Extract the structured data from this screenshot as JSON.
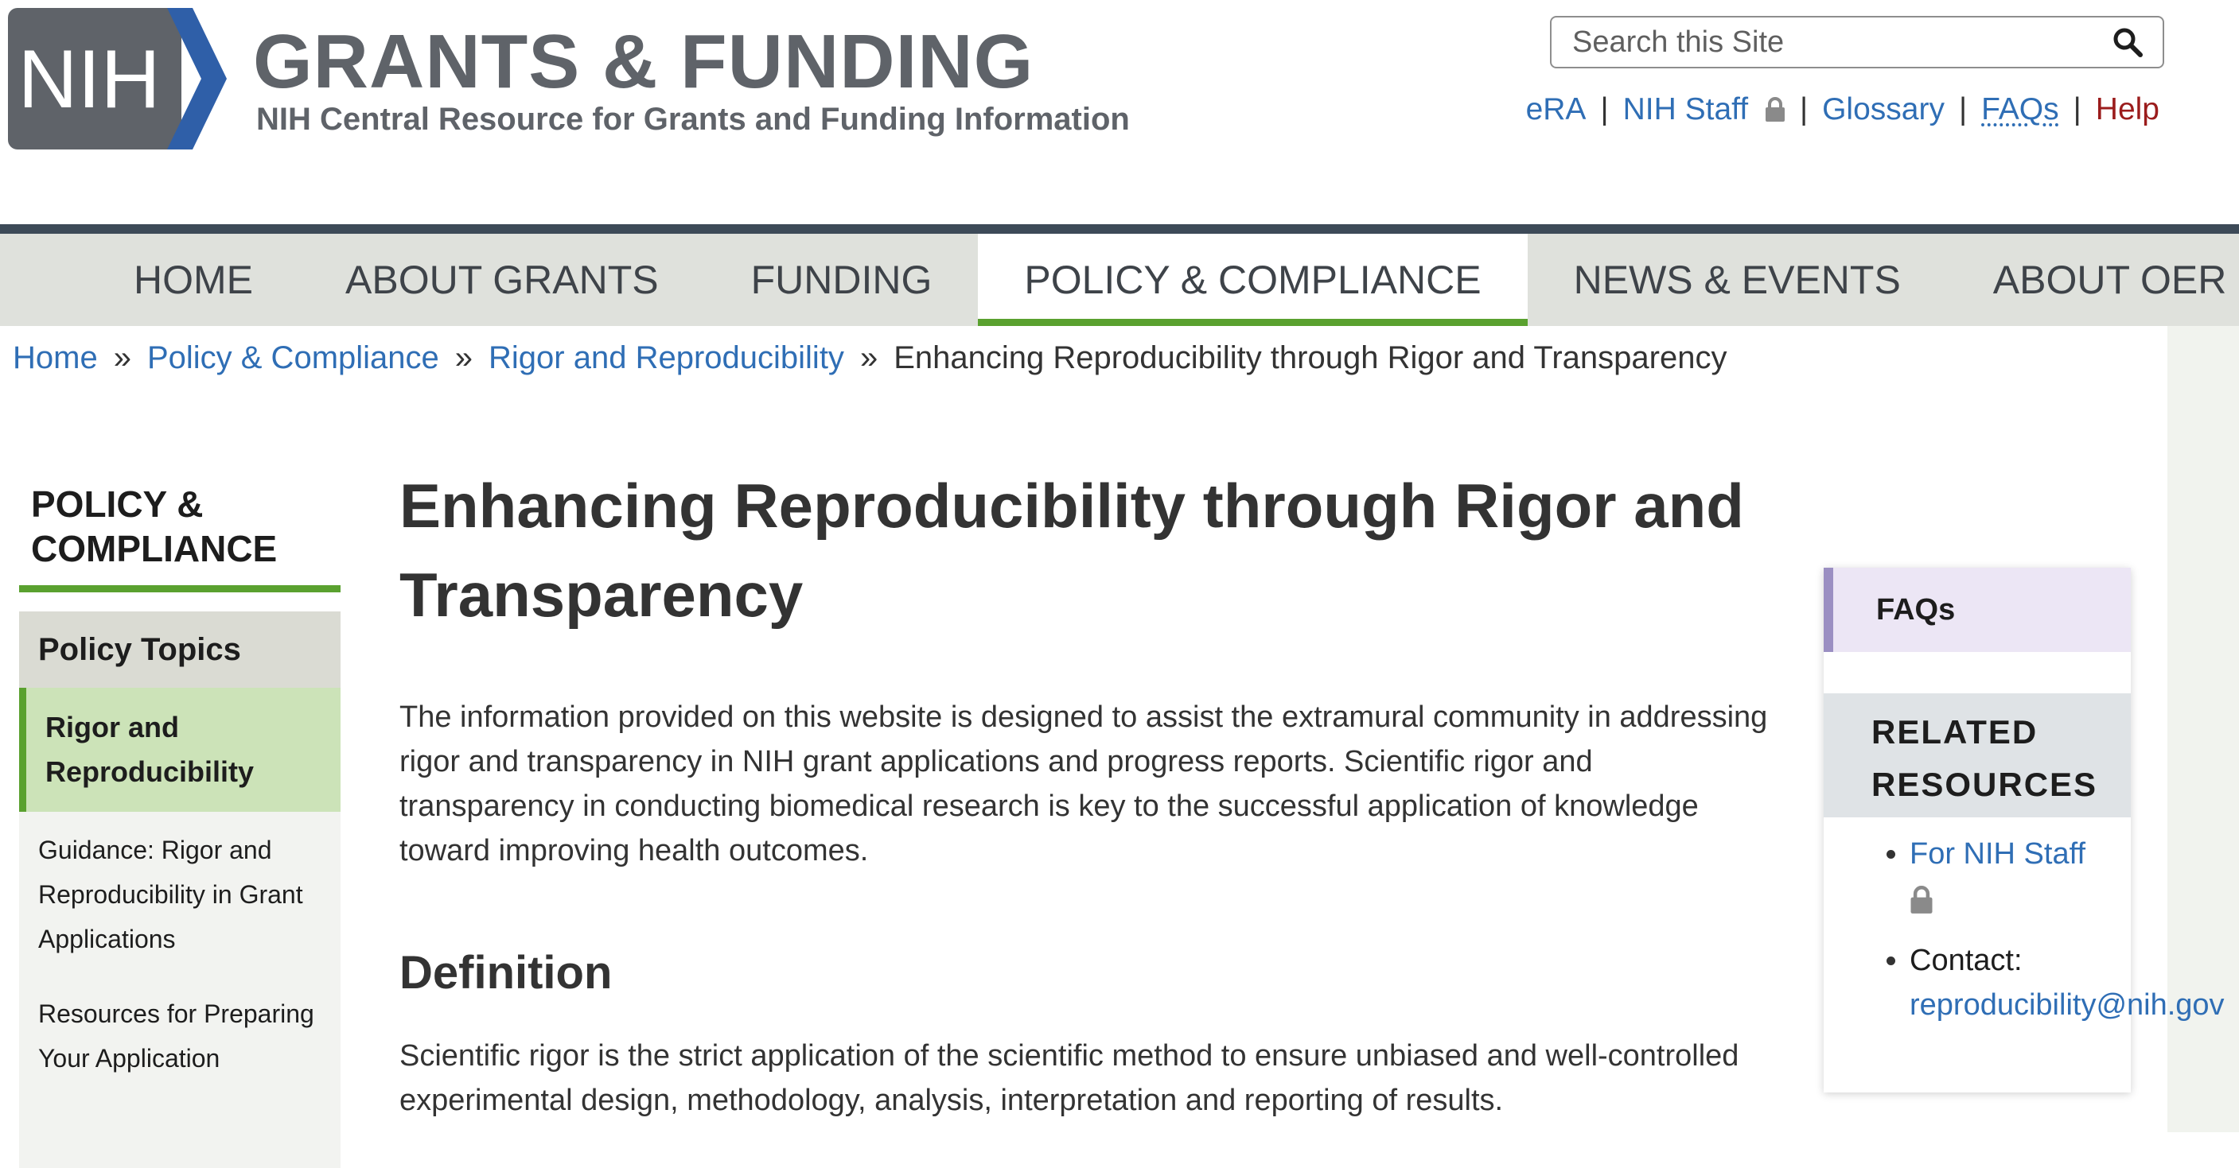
{
  "header": {
    "logo_text": "NIH",
    "site_title": "GRANTS & FUNDING",
    "tagline": "NIH Central Resource for Grants and Funding Information"
  },
  "search": {
    "placeholder": "Search this Site"
  },
  "utility_nav": {
    "items": [
      "eRA",
      "NIH Staff",
      "Glossary",
      "FAQs",
      "Help"
    ]
  },
  "main_nav": {
    "items": [
      "HOME",
      "ABOUT GRANTS",
      "FUNDING",
      "POLICY & COMPLIANCE",
      "NEWS & EVENTS",
      "ABOUT OER"
    ],
    "active": "POLICY & COMPLIANCE"
  },
  "breadcrumb": {
    "items": [
      "Home",
      "Policy & Compliance",
      "Rigor and Reproducibility"
    ],
    "separator": "»",
    "current": "Enhancing Reproducibility through Rigor and Transparency"
  },
  "sidebar": {
    "title": "POLICY & COMPLIANCE",
    "heading": "Policy Topics",
    "active_item": "Rigor and Reproducibility",
    "items": [
      "Guidance: Rigor and Reproducibility in Grant Applications",
      "Resources for Preparing Your Application"
    ]
  },
  "main": {
    "title": "Enhancing Reproducibility through Rigor and Transparency",
    "intro": "The information provided on this website is designed to assist the extramural community in addressing rigor and transparency in NIH grant applications and progress reports. Scientific rigor and transparency in conducting biomedical research is key to the successful application of knowledge toward improving health outcomes.",
    "section_heading": "Definition",
    "definition": "Scientific rigor is the strict application of the scientific method to ensure unbiased and well-controlled experimental design, methodology, analysis, interpretation and reporting of results."
  },
  "right_sidebar": {
    "faq_label": "FAQs",
    "related_title": "RELATED RESOURCES",
    "staff_link": "For NIH Staff",
    "contact_label": "Contact:",
    "contact_email": "reproducibility@nih.gov"
  },
  "colors": {
    "nav_active_underline": "#5aa12f",
    "link_blue": "#2f6eb5",
    "help_red": "#9b1c1c",
    "nav_background": "#dfe1dc",
    "nav_top_bar": "#3d4a58"
  }
}
